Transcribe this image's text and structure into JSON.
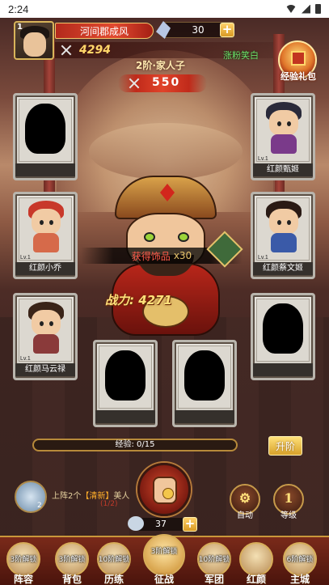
{
  "status_bar": {
    "time": "2:24"
  },
  "player": {
    "level": "1",
    "name": "河间郡成风",
    "power": "4294",
    "gems": "30"
  },
  "gift": {
    "label": "经验礼包",
    "sub_tag": "涨粉笑白"
  },
  "rank": {
    "title": "2阶·家人子",
    "power": "550"
  },
  "heroes": [
    {
      "slot": "left-1",
      "name": "",
      "lv": "",
      "locked": true
    },
    {
      "slot": "right-1",
      "name": "红颜甄姬",
      "lv": "Lv.1",
      "locked": false,
      "hair": "#2a2a3a",
      "body": "#7a3a8a"
    },
    {
      "slot": "left-2",
      "name": "红颜小乔",
      "lv": "Lv.1",
      "locked": false,
      "hair": "#c8382a",
      "body": "#d66a4a"
    },
    {
      "slot": "right-2",
      "name": "红颜蔡文姬",
      "lv": "Lv.1",
      "locked": false,
      "hair": "#2a1a14",
      "body": "#3a5aa8"
    },
    {
      "slot": "left-3",
      "name": "红颜马云禄",
      "lv": "Lv.1",
      "locked": false,
      "hair": "#3a2418",
      "body": "#8a3a3a"
    },
    {
      "slot": "right-3",
      "name": "",
      "lv": "",
      "locked": true
    },
    {
      "slot": "bottom-1",
      "name": "",
      "lv": "",
      "locked": true
    },
    {
      "slot": "bottom-2",
      "name": "",
      "lv": "",
      "locked": true
    }
  ],
  "drop": {
    "text": "获得饰品",
    "count": "x30"
  },
  "hero_power": "战力: 4271",
  "exp": {
    "label": "经验: 0/15",
    "fraction": 0.0
  },
  "advance_button": "升阶",
  "quest": {
    "num": "2",
    "text_prefix": "上阵2个",
    "text_highlight": "【清新】",
    "text_suffix": "美人",
    "progress": "(1/2)"
  },
  "coins": "37",
  "auto": {
    "glyph": "⚙",
    "label": "自动"
  },
  "level_btn": {
    "glyph": "1",
    "label": "等级"
  },
  "nav": [
    {
      "lock": "3阶解锁",
      "label": "阵容"
    },
    {
      "lock": "3阶解锁",
      "label": "背包"
    },
    {
      "lock": "10阶解锁",
      "label": "历练"
    },
    {
      "lock": "3阶解锁",
      "label": "征战"
    },
    {
      "lock": "10阶解锁",
      "label": "军团"
    },
    {
      "lock": "",
      "label": "红颜"
    },
    {
      "lock": "6阶解锁",
      "label": "主城"
    }
  ]
}
